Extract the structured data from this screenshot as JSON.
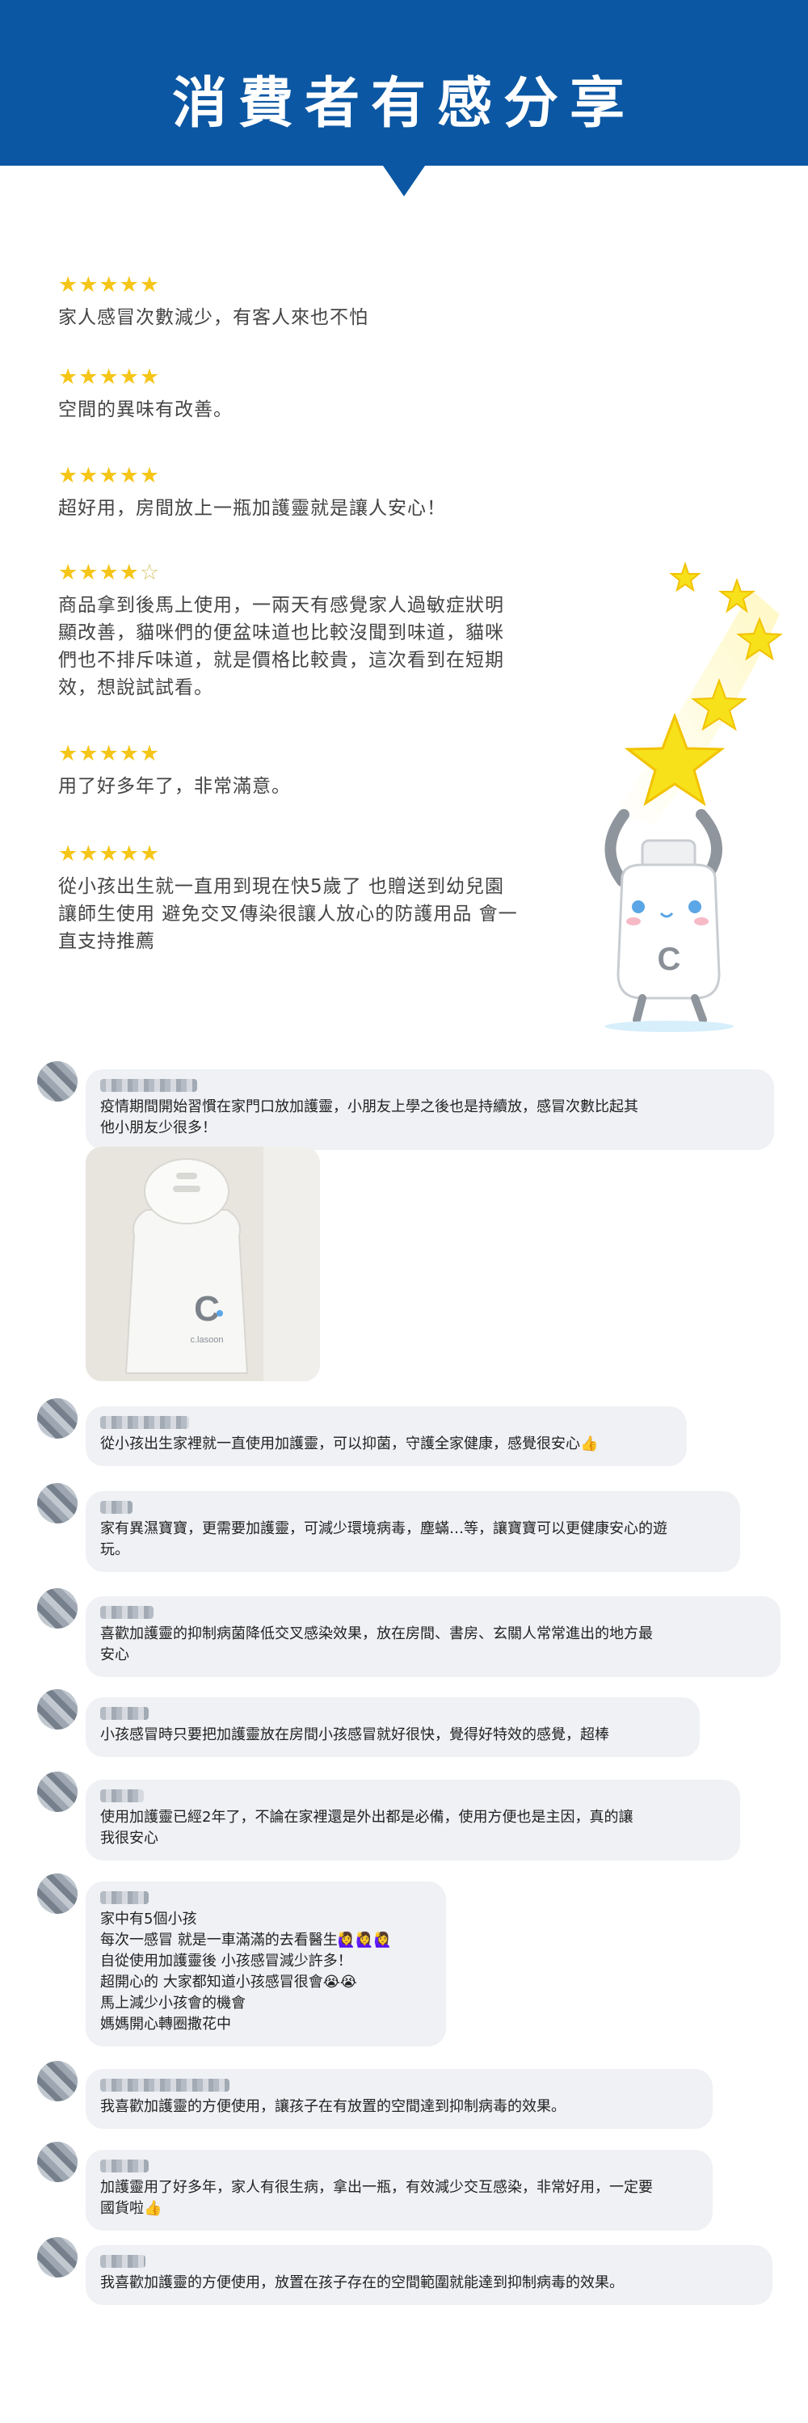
{
  "header": {
    "title": "消費者有感分享"
  },
  "colors": {
    "header_bg": "#0b57a3",
    "star": "#f5c518",
    "bubble_bg": "#eff1f4"
  },
  "reviews": [
    {
      "rating": 5,
      "text": "家人感冒次數減少，有客人來也不怕"
    },
    {
      "rating": 5,
      "text": "空間的異味有改善。"
    },
    {
      "rating": 5,
      "text": "超好用，房間放上一瓶加護靈就是讓人安心！"
    },
    {
      "rating": 4,
      "text": "商品拿到後馬上使用，一兩天有感覺家人過敏症狀明\n顯改善，貓咪們的便盆味道也比較沒聞到味道，貓咪\n們也不排斥味道，就是價格比較貴，這次看到在短期\n效，想說試試看。"
    },
    {
      "rating": 5,
      "text": "用了好多年了，非常滿意。"
    },
    {
      "rating": 5,
      "text": "從小孩出生就一直用到現在快5歲了 也贈送到幼兒園\n讓師生使用 避免交叉傳染很讓人放心的防護用品 會一\n直支持推薦"
    }
  ],
  "mascot": {
    "logo_letter": "C"
  },
  "product_photo": {
    "brand": "c.lasoon",
    "logo_letter": "C"
  },
  "comments": [
    {
      "text": "疫情期間開始習慣在家門口放加護靈，小朋友上學之後也是持續放，感冒次數比起其\n他小朋友少很多！"
    },
    {
      "text": "從小孩出生家裡就一直使用加護靈，可以抑菌，守護全家健康，感覺很安心👍"
    },
    {
      "text": "家有異濕寶寶，更需要加護靈，可減少環境病毒，塵蟎…等，讓寶寶可以更健康安心的遊\n玩。"
    },
    {
      "text": "喜歡加護靈的抑制病菌降低交叉感染效果，放在房間、書房、玄關人常常進出的地方最\n安心"
    },
    {
      "text": "小孩感冒時只要把加護靈放在房間小孩感冒就好很快，覺得好特效的感覺，超棒"
    },
    {
      "text": "使用加護靈已經2年了，不論在家裡還是外出都是必備，使用方便也是主因，真的讓\n我很安心"
    },
    {
      "text": "家中有5個小孩\n每次一感冒 就是一車滿滿的去看醫生🙋‍♀️🙋‍♀️🙋‍♀️\n自從使用加護靈後 小孩感冒減少許多！\n超開心的 大家都知道小孩感冒很會😭😭\n馬上減少小孩會的機會\n媽媽開心轉圈撒花中"
    },
    {
      "text": "我喜歡加護靈的方便使用，讓孩子在有放置的空間達到抑制病毒的效果。"
    },
    {
      "text": "加護靈用了好多年，家人有很生病，拿出一瓶，有效減少交互感染，非常好用，一定要\n國貨啦👍"
    },
    {
      "text": "我喜歡加護靈的方便使用，放置在孩子存在的空間範圍就能達到抑制病毒的效果。"
    }
  ]
}
